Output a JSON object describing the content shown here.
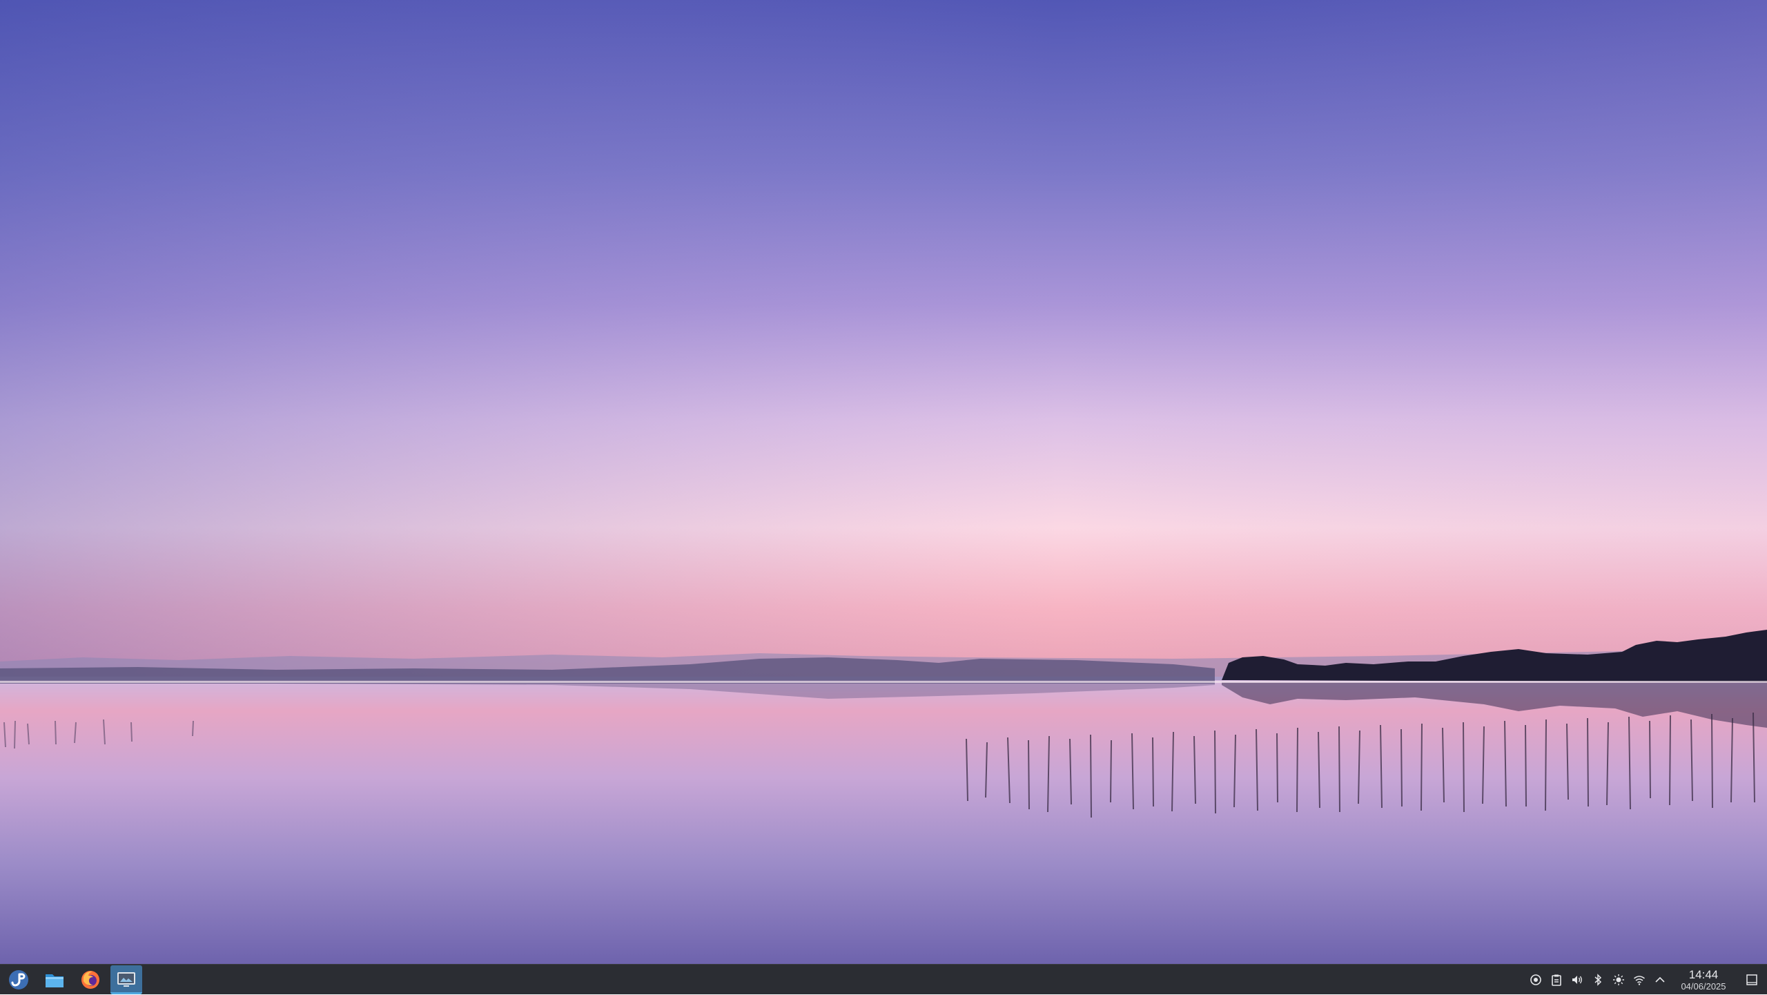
{
  "taskbar": {
    "launchers": [
      {
        "icon": "fedora-logo-icon",
        "label": "Application Launcher"
      },
      {
        "icon": "file-manager-icon",
        "label": "Dolphin"
      },
      {
        "icon": "firefox-icon",
        "label": "Firefox"
      },
      {
        "icon": "screenshot-app-icon",
        "label": "Spectacle",
        "active": true
      }
    ],
    "tray_icons": [
      "network-globe-icon",
      "clipboard-icon",
      "volume-icon",
      "bluetooth-icon",
      "brightness-icon",
      "wifi-icon",
      "expand-tray-chevron-icon"
    ],
    "clock": {
      "time": "14:44",
      "date": "04/06/2025"
    },
    "show_desktop_icon": "show-desktop-icon"
  },
  "colors": {
    "taskbar_bg": "#2b2d33",
    "active_task": "#3d6f9c",
    "sky_top": "#5458b5",
    "horizon": "#ffd8e2"
  }
}
